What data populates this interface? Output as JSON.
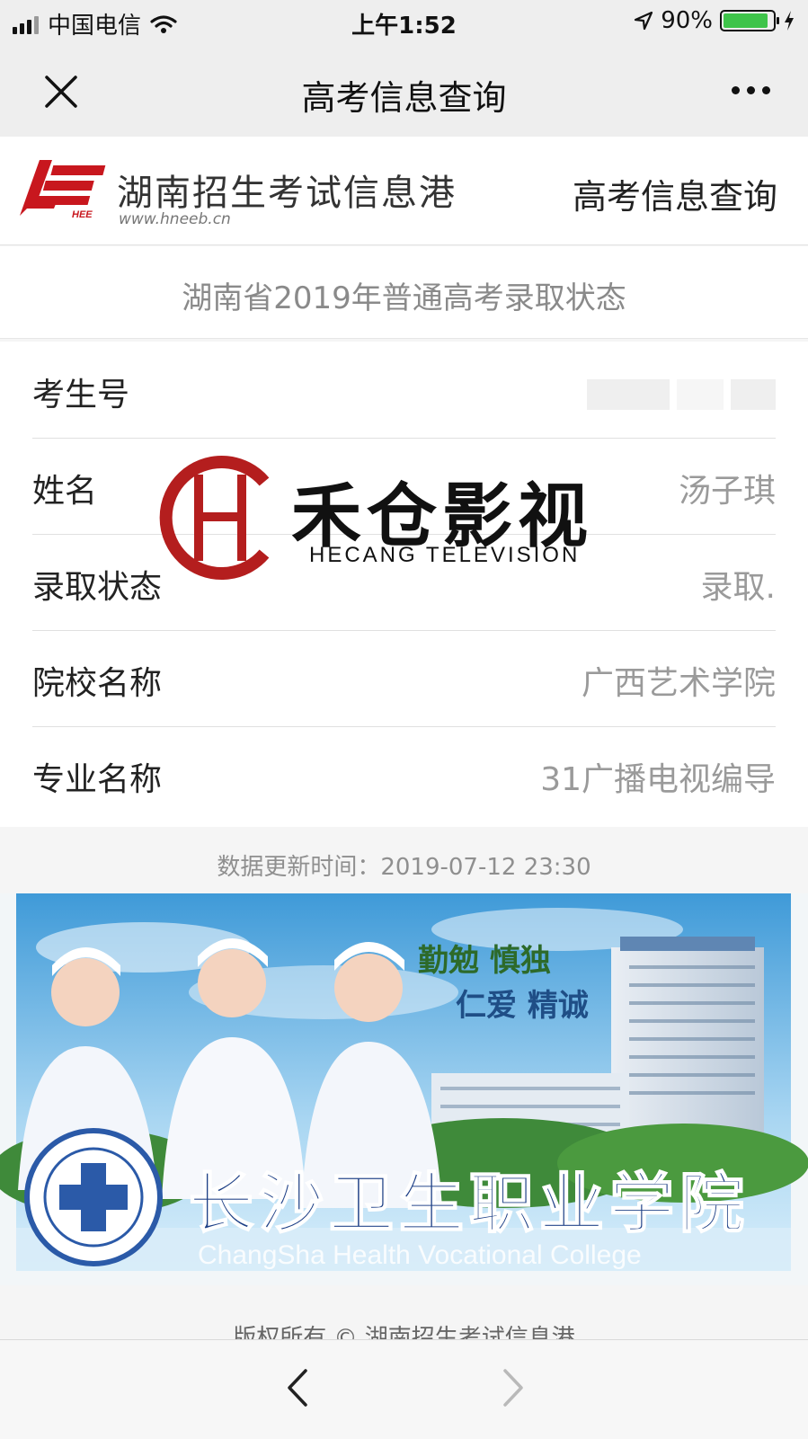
{
  "status_bar": {
    "carrier": "中国电信",
    "time": "上午1:52",
    "battery_percent": "90%",
    "battery_level": 0.9,
    "battery_color": "#3ec44a"
  },
  "nav": {
    "title": "高考信息查询",
    "close_icon": "close-icon",
    "more_icon": "more-icon"
  },
  "header": {
    "site_name": "湖南招生考试信息港",
    "site_url": "www.hneeb.cn",
    "logo_text": "HEE",
    "link": "高考信息查询"
  },
  "subtitle": "湖南省2019年普通高考录取状态",
  "result": {
    "rows": [
      {
        "label": "考生号",
        "value": ""
      },
      {
        "label": "姓名",
        "value": "汤子琪"
      },
      {
        "label": "录取状态",
        "value": "录取."
      },
      {
        "label": "院校名称",
        "value": "广西艺术学院"
      },
      {
        "label": "专业名称",
        "value": "31广播电视编导"
      }
    ]
  },
  "updated": "数据更新时间：2019-07-12 23:30",
  "banner": {
    "motto_1": "勤勉 慎独",
    "motto_2": "仁爱 精诚",
    "college_cn": "长沙卫生职业学院",
    "college_en": "ChangSha Health Vocational College"
  },
  "copyright": "版权所有 © 湖南招生考试信息港",
  "watermark": {
    "cn": "禾仓影视",
    "en": "HECANG TELEVISION"
  },
  "colors": {
    "brand_red": "#c8171e",
    "watermark_red": "#b41e1e"
  }
}
